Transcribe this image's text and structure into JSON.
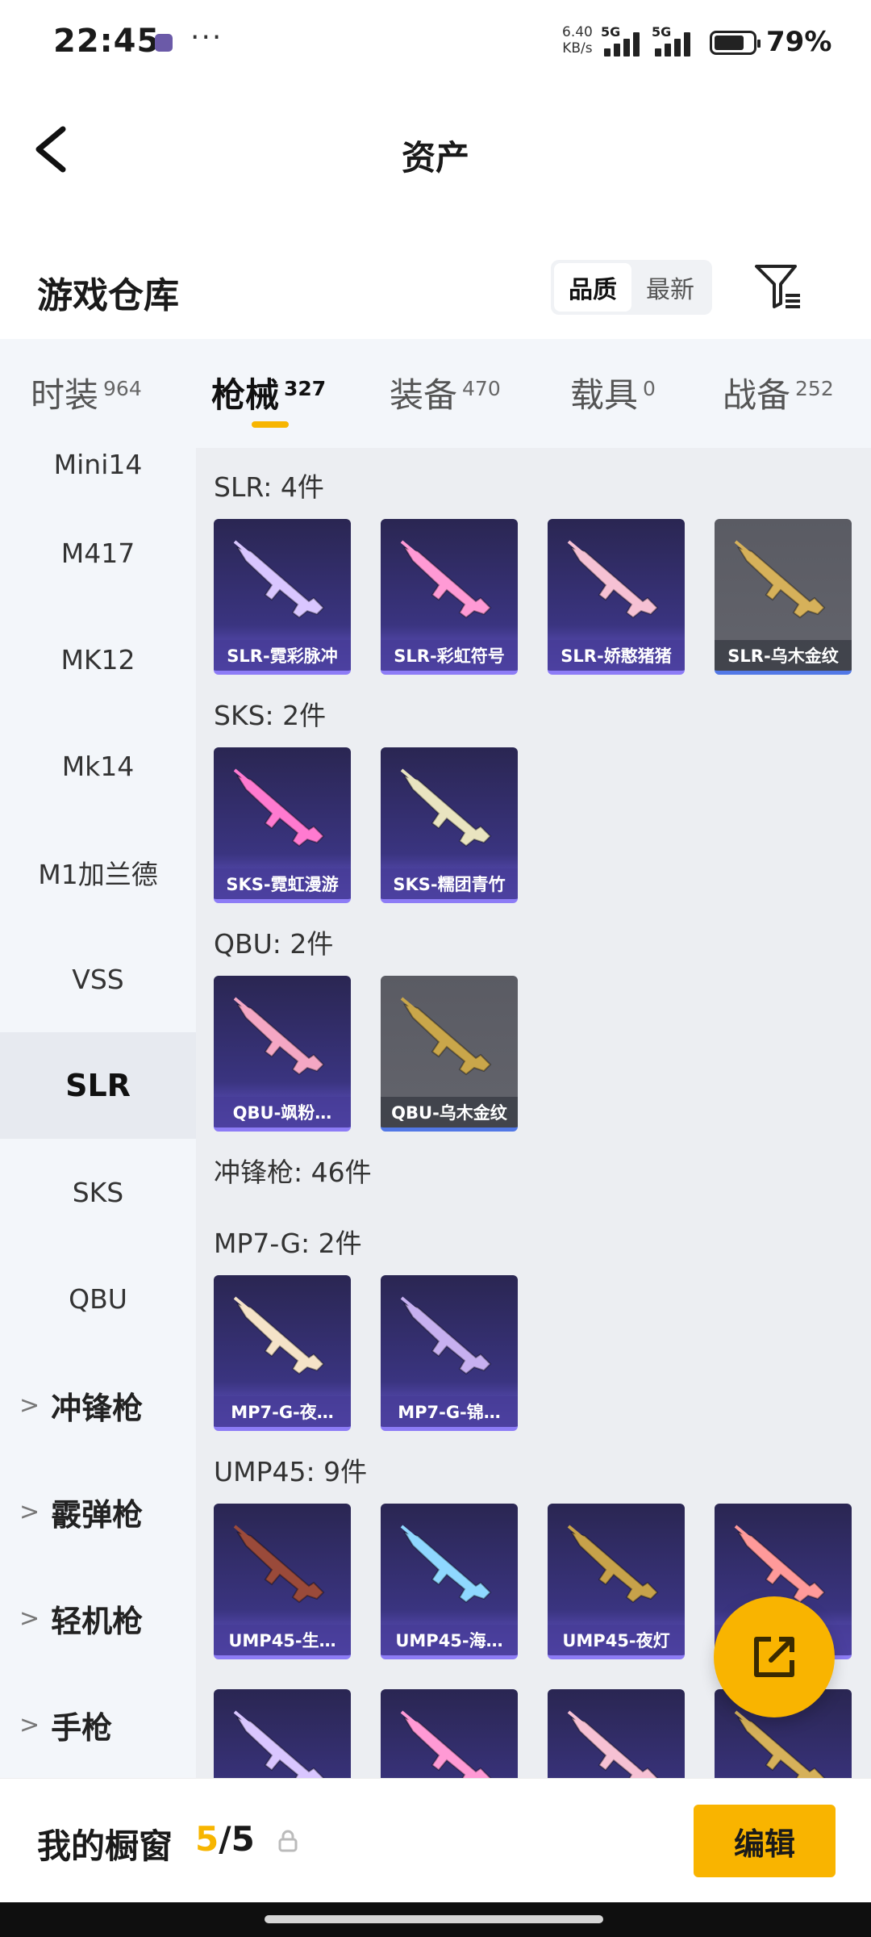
{
  "status_bar": {
    "time": "22:45",
    "more": "···",
    "net_speed_value": "6.40",
    "net_speed_unit": "KB/s",
    "sim1": "5G",
    "sim2": "5G",
    "battery_percent": "79%",
    "battery_level": 0.79
  },
  "header": {
    "title": "资产"
  },
  "warehouse": {
    "title": "游戏仓库",
    "sort_options": [
      "品质",
      "最新"
    ],
    "sort_selected": "品质"
  },
  "category_tabs": [
    {
      "label": "时装",
      "count": "964",
      "active": false
    },
    {
      "label": "枪械",
      "count": "327",
      "active": true
    },
    {
      "label": "装备",
      "count": "470",
      "active": false
    },
    {
      "label": "载具",
      "count": "0",
      "active": false
    },
    {
      "label": "战备",
      "count": "252",
      "active": false
    }
  ],
  "sidebar": {
    "partial_item": "Mini14",
    "items": [
      {
        "label": "M417"
      },
      {
        "label": "MK12"
      },
      {
        "label": "Mk14"
      },
      {
        "label": "M1加兰德"
      },
      {
        "label": "VSS"
      },
      {
        "label": "SLR",
        "active": true
      },
      {
        "label": "SKS"
      },
      {
        "label": "QBU"
      }
    ],
    "groups": [
      {
        "label": "冲锋枪"
      },
      {
        "label": "霰弹枪"
      },
      {
        "label": "轻机枪"
      },
      {
        "label": "手枪"
      }
    ]
  },
  "sections": [
    {
      "title": "SLR: 4件",
      "items": [
        {
          "name": "SLR-霓彩脉冲",
          "rarity": "purple"
        },
        {
          "name": "SLR-彩虹符号",
          "rarity": "purple"
        },
        {
          "name": "SLR-娇憨猪猪",
          "rarity": "purple"
        },
        {
          "name": "SLR-乌木金纹",
          "rarity": "gray"
        }
      ]
    },
    {
      "title": "SKS: 2件",
      "items": [
        {
          "name": "SKS-霓虹漫游",
          "rarity": "purple"
        },
        {
          "name": "SKS-糯团青竹",
          "rarity": "purple"
        }
      ]
    },
    {
      "title": "QBU: 2件",
      "items": [
        {
          "name": "QBU-飒粉…",
          "rarity": "purple"
        },
        {
          "name": "QBU-乌木金纹",
          "rarity": "gray"
        }
      ]
    },
    {
      "title": "冲锋枪: 46件",
      "items": []
    },
    {
      "title": "MP7-G: 2件",
      "items": [
        {
          "name": "MP7-G-夜…",
          "rarity": "purple"
        },
        {
          "name": "MP7-G-锦…",
          "rarity": "purple"
        }
      ]
    },
    {
      "title": "UMP45: 9件",
      "items": [
        {
          "name": "UMP45-生…",
          "rarity": "purple"
        },
        {
          "name": "UMP45-海…",
          "rarity": "purple"
        },
        {
          "name": "UMP45-夜灯",
          "rarity": "purple"
        },
        {
          "name": "",
          "rarity": "purple"
        }
      ]
    }
  ],
  "showcase": {
    "label": "我的橱窗",
    "current": "5",
    "separator": "/",
    "total": "5",
    "edit_label": "编辑"
  },
  "colors": {
    "accent": "#f9b400",
    "card_purple": "#3a3480",
    "card_gray": "#5f6068",
    "panel_bg": "#f3f6fa"
  }
}
